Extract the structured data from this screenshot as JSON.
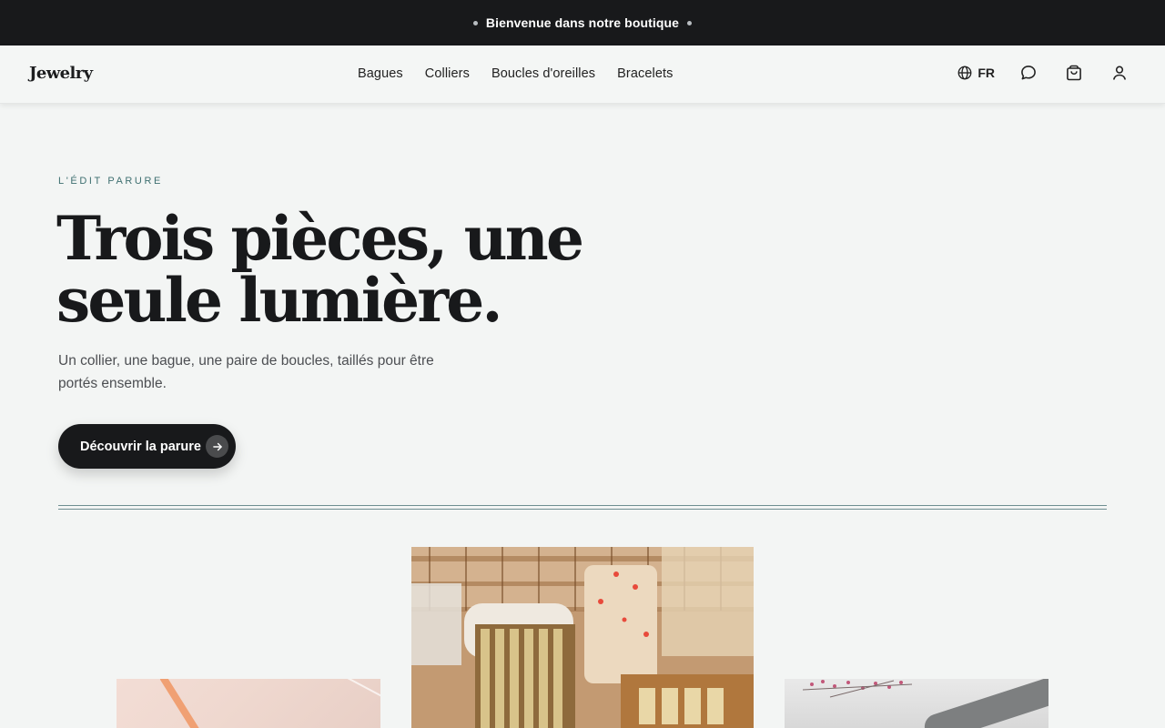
{
  "announcement": {
    "text": "Bienvenue dans notre boutique"
  },
  "header": {
    "logo": "Jewelry",
    "nav": [
      "Bagues",
      "Colliers",
      "Boucles d'oreilles",
      "Bracelets"
    ],
    "language": "FR",
    "icons": [
      "globe-icon",
      "chat-icon",
      "cart-icon",
      "user-icon"
    ]
  },
  "hero": {
    "eyebrow": "L'ÉDIT PARURE",
    "title_line1": "Trois pièces, une",
    "title_line2": "seule lumière.",
    "subtitle": "Un collier, une bague, une paire de boucles, taillés pour être portés ensemble.",
    "cta_label": "Découvrir la parure",
    "cta_icon": "arrow-right-icon"
  },
  "colors": {
    "announcement_bg": "#18191b",
    "page_bg": "#f3f5f4",
    "accent": "#3e6f70",
    "button_bg": "#18191b"
  }
}
